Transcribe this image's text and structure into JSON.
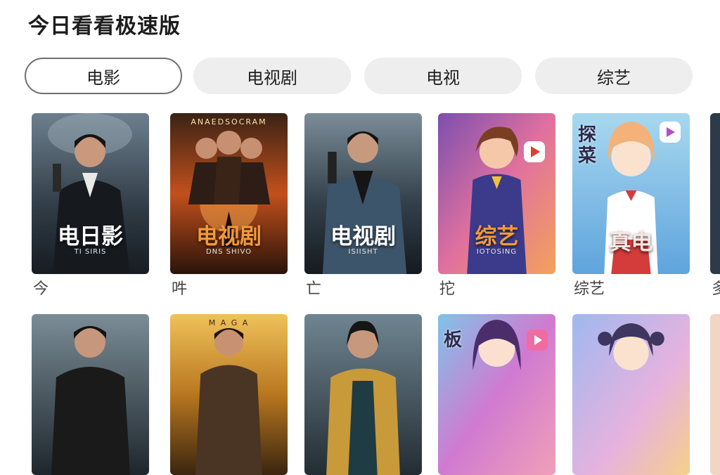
{
  "app": {
    "title": "今日看看极速版"
  },
  "tabs": [
    {
      "label": "电影",
      "active": true
    },
    {
      "label": "电视剧",
      "active": false
    },
    {
      "label": "电视",
      "active": false
    },
    {
      "label": "综艺",
      "active": false
    }
  ],
  "row1": [
    {
      "poster_title": "电日影",
      "poster_sub": "TI SIRIS",
      "label": "今"
    },
    {
      "poster_top": "ANAEDSOCRAM",
      "poster_title": "电视剧",
      "poster_sub": "DNS SHIVO",
      "label": "吽"
    },
    {
      "poster_title": "电视剧",
      "poster_sub": "ISIISHT",
      "label": "亡"
    },
    {
      "poster_title": "综艺",
      "poster_sub": "IOTOSING",
      "label": "拕"
    },
    {
      "poster_corner": "探\n菜",
      "poster_title": "真电",
      "label": "综艺"
    },
    {
      "label": "多"
    }
  ],
  "row2": [
    {},
    {
      "poster_top": "M A G A"
    },
    {},
    {
      "poster_corner": "板"
    },
    {}
  ],
  "colors": {
    "tab_bg": "#eeeeee",
    "tab_active_border": "#6f6f6f",
    "title": "#1c1c1c"
  }
}
